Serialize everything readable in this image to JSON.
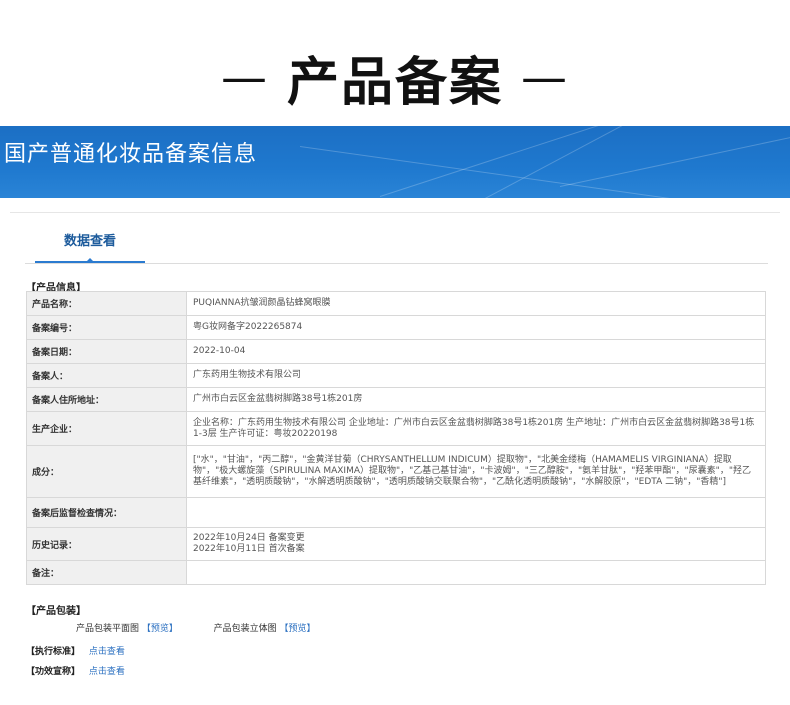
{
  "header": {
    "dash": "—",
    "title": "产品备案"
  },
  "banner": {
    "title": "国产普通化妆品备案信息"
  },
  "tabs": [
    {
      "label": "数据查看",
      "active": true
    }
  ],
  "sections": {
    "product_info": "【产品信息】",
    "product_packaging": "【产品包装】",
    "exec_standard": "【执行标准】",
    "efficacy_claim": "【功效宣称】"
  },
  "product_info": {
    "rows": [
      {
        "key": "产品名称：",
        "value": "PUQIANNA抗皱润颜晶钻蜂窝眼膜"
      },
      {
        "key": "备案编号：",
        "value": "粤G妆网备字2022265874"
      },
      {
        "key": "备案日期：",
        "value": "2022-10-04"
      },
      {
        "key": "备案人：",
        "value": "广东药用生物技术有限公司"
      },
      {
        "key": "备案人住所地址：",
        "value": "广州市白云区金盆翡树脚路38号1栋201房"
      },
      {
        "key": "生产企业：",
        "value": "企业名称：广东药用生物技术有限公司 企业地址：广州市白云区金盆翡树脚路38号1栋201房 生产地址：广州市白云区金盆翡树脚路38号1栋1-3层 生产许可证：粤妆20220198"
      },
      {
        "key": "成分：",
        "value": "[\"水\"，\"甘油\"，\"丙二醇\"，\"金黄洋甘菊（CHRYSANTHELLUM INDICUM）提取物\"，\"北美金缕梅（HAMAMELIS VIRGINIANA）提取物\"，\"极大螺旋藻（SPIRULINA MAXIMA）提取物\"，\"乙基己基甘油\"，\"卡波姆\"，\"三乙醇胺\"，\"氨羊甘肽\"，\"羟苯甲酯\"，\"尿囊素\"，\"羟乙基纤维素\"，\"透明质酸钠\"，\"水解透明质酸钠\"，\"透明质酸钠交联聚合物\"，\"乙酰化透明质酸钠\"，\"水解胶原\"，\"EDTA 二钠\"，\"香精\"]"
      },
      {
        "key": "备案后监督检查情况：",
        "value": ""
      },
      {
        "key": "历史记录：",
        "value": "2022年10月24日 备案变更\n2022年10月11日 首次备案"
      },
      {
        "key": "备注：",
        "value": ""
      }
    ]
  },
  "packaging": {
    "flat_label": "产品包装平面图",
    "solid_label": "产品包装立体图",
    "preview_link": "【预览】"
  },
  "standard": {
    "link": "点击查看"
  },
  "claim": {
    "link": "点击查看"
  }
}
